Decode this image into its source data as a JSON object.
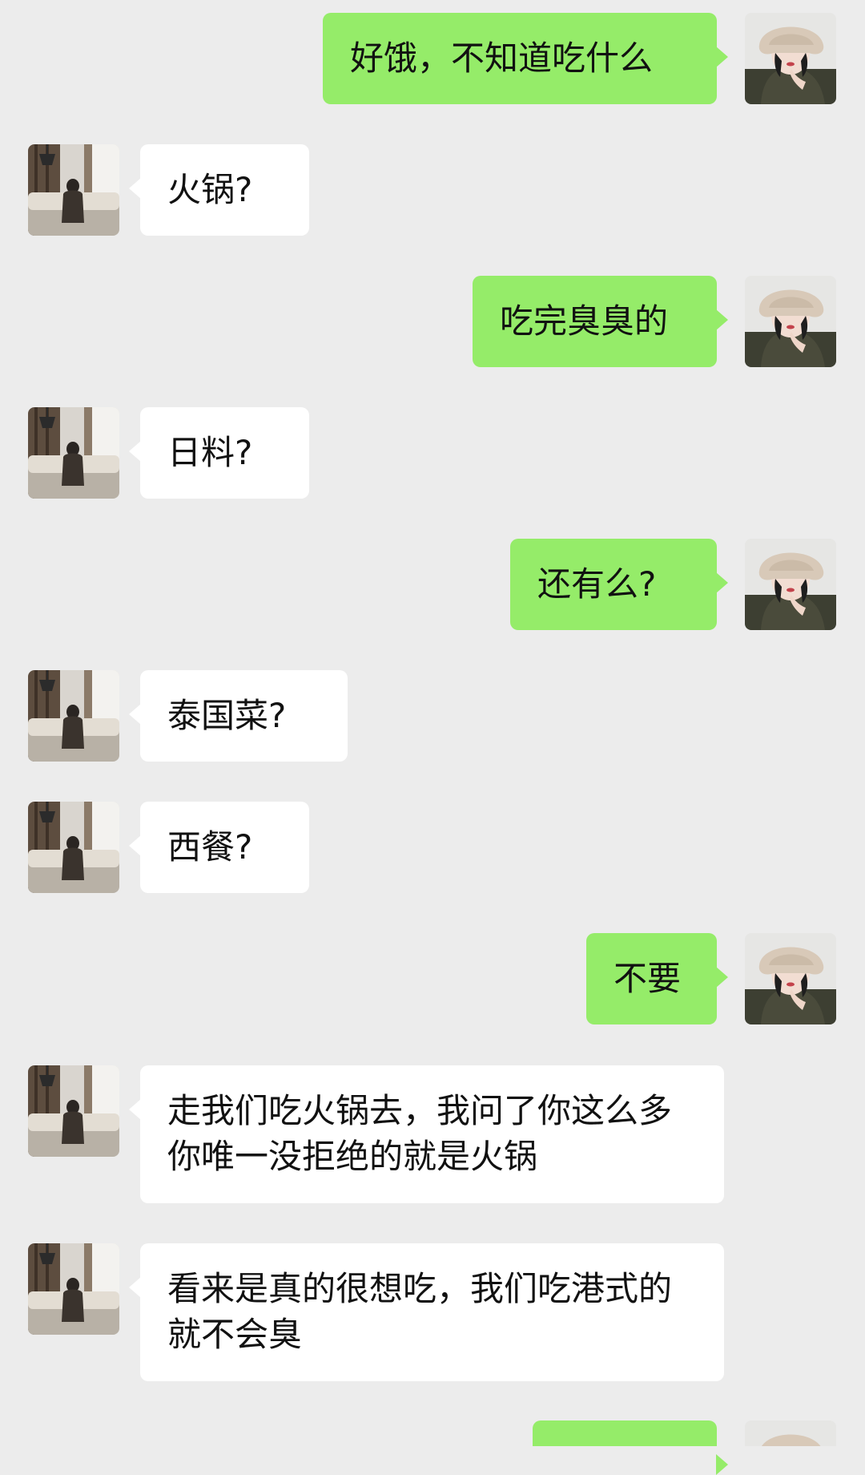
{
  "colors": {
    "background": "#ececec",
    "sent_bubble": "#95ec69",
    "received_bubble": "#ffffff",
    "text": "#111111"
  },
  "participants": {
    "me": {
      "avatar_icon": "woman-bucket-hat-avatar-icon"
    },
    "friend": {
      "avatar_icon": "living-room-sofa-avatar-icon"
    }
  },
  "messages": [
    {
      "sender": "me",
      "text": "好饿，不知道吃什么"
    },
    {
      "sender": "friend",
      "text": "火锅?"
    },
    {
      "sender": "me",
      "text": "吃完臭臭的"
    },
    {
      "sender": "friend",
      "text": "日料?"
    },
    {
      "sender": "me",
      "text": "还有么?"
    },
    {
      "sender": "friend",
      "text": "泰国菜?"
    },
    {
      "sender": "friend",
      "text": "西餐?"
    },
    {
      "sender": "me",
      "text": "不要"
    },
    {
      "sender": "friend",
      "text": "走我们吃火锅去，我问了你这么多你唯一没拒绝的就是火锅"
    },
    {
      "sender": "friend",
      "text": "看来是真的很想吃，我们吃港式的就不会臭"
    },
    {
      "sender": "me",
      "text": ""
    }
  ]
}
